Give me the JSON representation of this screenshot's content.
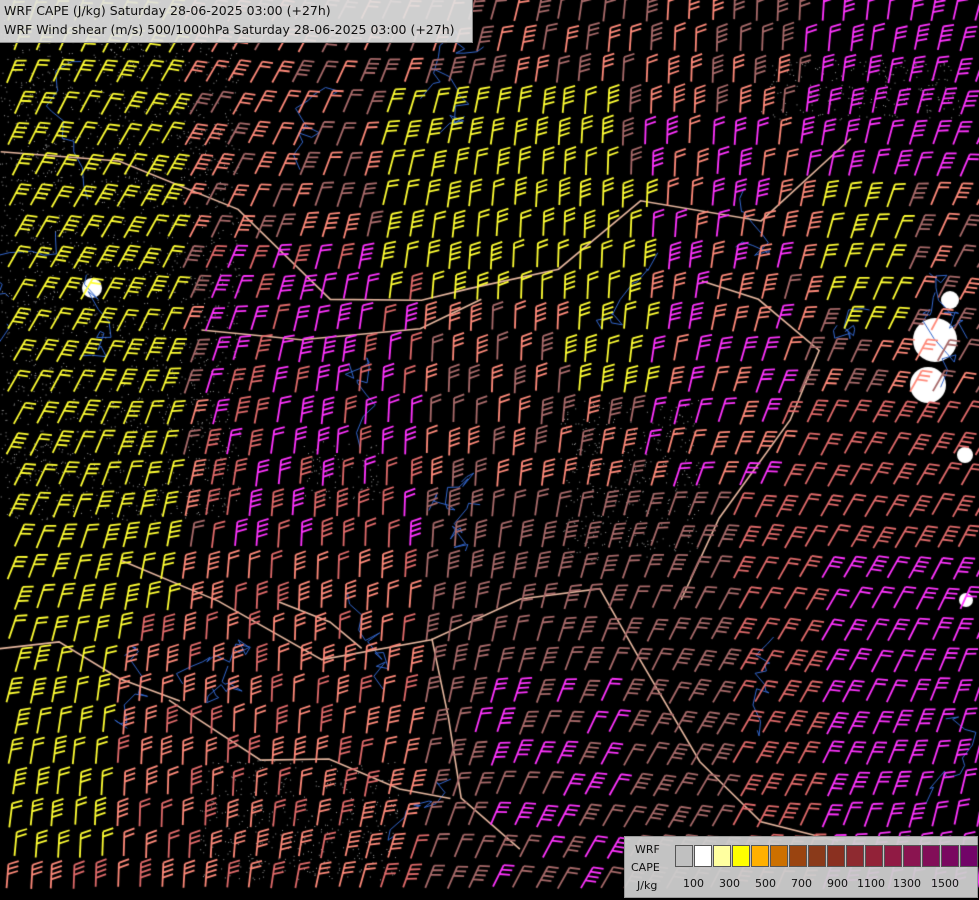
{
  "title": {
    "line1": "WRF CAPE (J/kg) Saturday 28-06-2025 03:00 (+27h)",
    "line2": "WRF Wind shear (m/s) 500/1000hPa Saturday 28-06-2025 03:00 (+27h)"
  },
  "legend": {
    "model": "WRF",
    "variable": "CAPE",
    "unit": "J/kg",
    "tick_labels": [
      "100",
      "300",
      "500",
      "700",
      "900",
      "1100",
      "1300",
      "1500"
    ],
    "colors": [
      "#c0c0c0",
      "#ffffff",
      "#ffffa0",
      "#ffff00",
      "#ffb000",
      "#cc7000",
      "#9a4410",
      "#8a3a1a",
      "#8a3020",
      "#8e2a30",
      "#922238",
      "#901a44",
      "#8a1450",
      "#820e58",
      "#7a0860",
      "#720468"
    ]
  },
  "map_style": {
    "background": "#000000",
    "barb_colors": [
      "#ffff33",
      "#ff33ff",
      "#ff8a7a",
      "#e06a6a",
      "#a86a6a",
      "#d4a838"
    ],
    "border_color": "#e8b8a0",
    "river_color": "#3366cc"
  }
}
